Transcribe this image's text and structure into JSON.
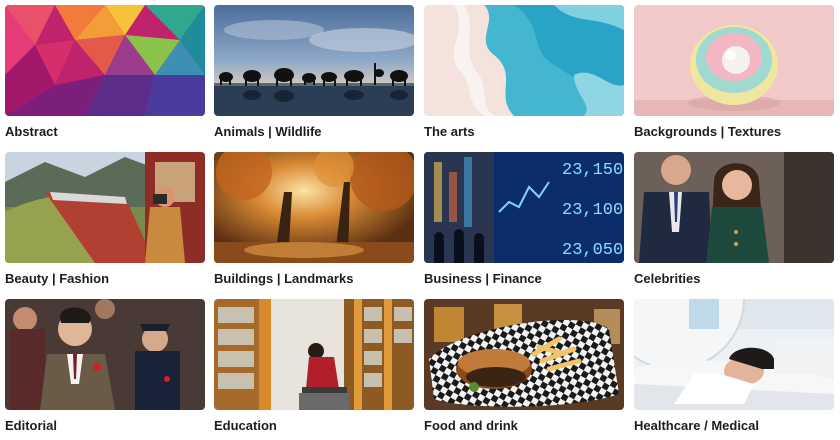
{
  "categories": [
    {
      "label": "Abstract",
      "image": "abstract-polygon-image"
    },
    {
      "label": "Animals | Wildlife",
      "image": "elephants-silhouette-image"
    },
    {
      "label": "The arts",
      "image": "blue-paint-wave-image"
    },
    {
      "label": "Backgrounds | Textures",
      "image": "pastel-sphere-image"
    },
    {
      "label": "Beauty | Fashion",
      "image": "train-photographer-image"
    },
    {
      "label": "Buildings | Landmarks",
      "image": "autumn-forest-image"
    },
    {
      "label": "Business | Finance",
      "image": "stock-ticker-street-image"
    },
    {
      "label": "Celebrities",
      "image": "royal-couple-image"
    },
    {
      "label": "Editorial",
      "image": "politician-crowd-image"
    },
    {
      "label": "Education",
      "image": "library-reader-image"
    },
    {
      "label": "Food and drink",
      "image": "burger-fries-basket-image"
    },
    {
      "label": "Healthcare / Medical",
      "image": "mri-scanner-image"
    }
  ],
  "ticker_values": [
    "23,150",
    "23,100",
    "23,050"
  ]
}
